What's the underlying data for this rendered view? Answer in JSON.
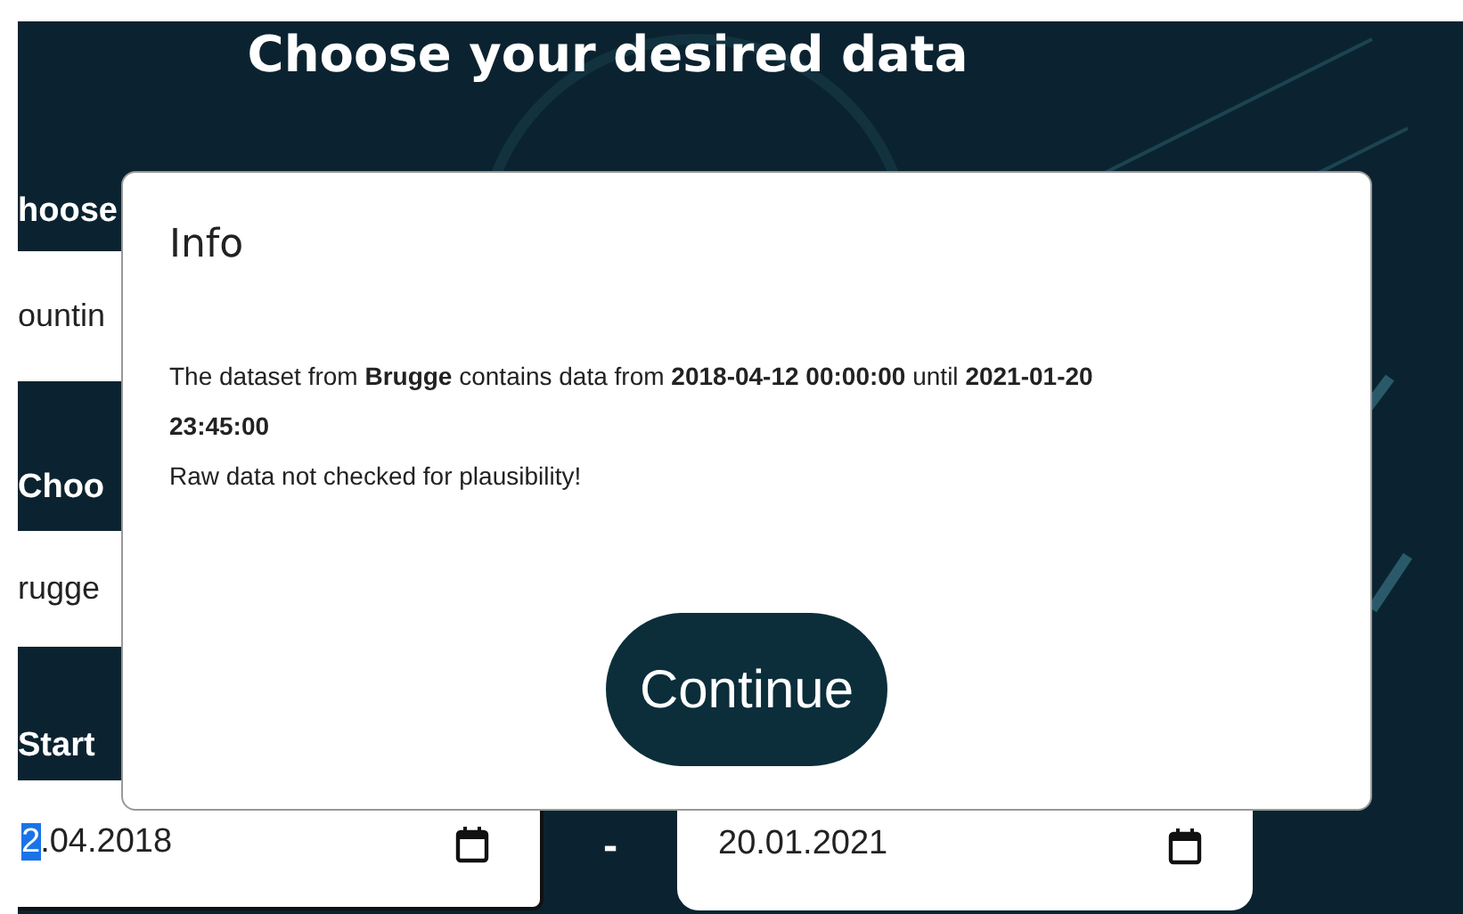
{
  "page": {
    "title": "Choose your desired data"
  },
  "form": [
    {
      "kind": "label",
      "text": "hoose"
    },
    {
      "kind": "select",
      "value": "ountin"
    },
    {
      "kind": "label",
      "text": "Choo"
    },
    {
      "kind": "select",
      "value": "rugge"
    },
    {
      "kind": "label",
      "text": "Start"
    }
  ],
  "date_range": {
    "start": {
      "value": "2.04.2018",
      "text_selected": true
    },
    "separator": "-",
    "end": {
      "value": "20.01.2021",
      "text_selected": false
    }
  },
  "dialog": {
    "title": "Info",
    "paragraphs": [
      "The dataset from **Brugge** contains data from **2018-04-12 00:00:00** until **2021-01-20 23:45:00**",
      "Raw data not checked for plausibility!"
    ],
    "button": "Continue"
  }
}
